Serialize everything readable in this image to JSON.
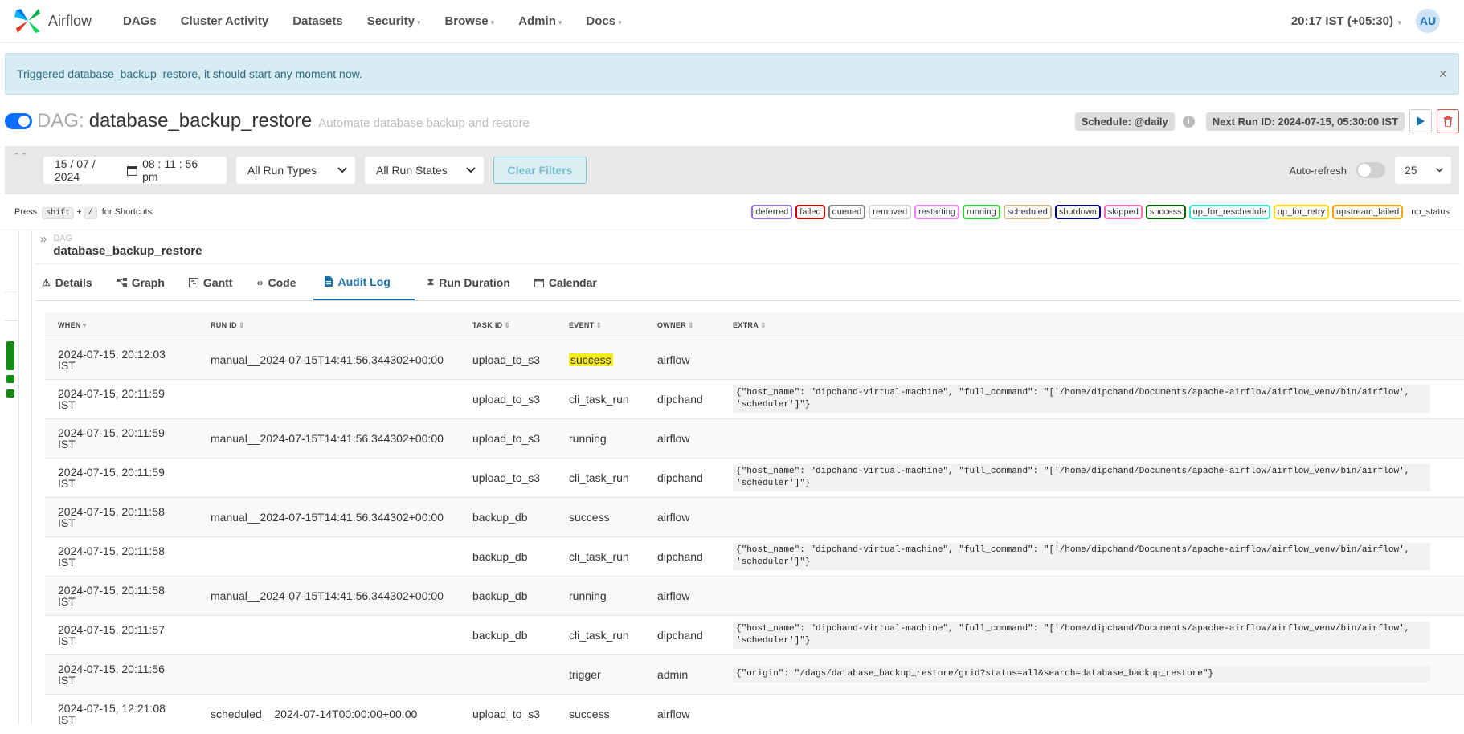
{
  "nav": {
    "brand": "Airflow",
    "items": [
      "DAGs",
      "Cluster Activity",
      "Datasets",
      "Security",
      "Browse",
      "Admin",
      "Docs"
    ],
    "clock": "20:17 IST (+05:30)",
    "avatar": "AU"
  },
  "alert": {
    "message": "Triggered database_backup_restore, it should start any moment now.",
    "close": "×"
  },
  "dag": {
    "label": "DAG:",
    "id": "database_backup_restore",
    "description": "Automate database backup and restore",
    "schedule": "Schedule: @daily",
    "next_run": "Next Run ID: 2024-07-15, 05:30:00 IST"
  },
  "filters": {
    "date": "15 / 07 / 2024",
    "time": "08 : 11 : 56   pm",
    "run_types": "All Run Types",
    "run_states": "All Run States",
    "clear": "Clear Filters",
    "autorefresh": "Auto-refresh",
    "page_size": "25"
  },
  "shortcuts": {
    "press": "Press",
    "key1": "shift",
    "plus": "+",
    "key2": "/",
    "suffix": "for Shortcuts"
  },
  "legend": {
    "states": [
      {
        "name": "deferred",
        "color": "#9370db"
      },
      {
        "name": "failed",
        "color": "#cc0000"
      },
      {
        "name": "queued",
        "color": "#808080"
      },
      {
        "name": "removed",
        "color": "#d3d3d3"
      },
      {
        "name": "restarting",
        "color": "#ee82ee"
      },
      {
        "name": "running",
        "color": "#32cd32"
      },
      {
        "name": "scheduled",
        "color": "#d2b48c"
      },
      {
        "name": "shutdown",
        "color": "#00008b"
      },
      {
        "name": "skipped",
        "color": "#ff69b4"
      },
      {
        "name": "success",
        "color": "#006400"
      },
      {
        "name": "up_for_reschedule",
        "color": "#40e0d0"
      },
      {
        "name": "up_for_retry",
        "color": "#ffd700"
      },
      {
        "name": "upstream_failed",
        "color": "#ffa500"
      }
    ],
    "no_status": "no_status"
  },
  "breadcrumb": {
    "lead": "DAG",
    "id": "database_backup_restore"
  },
  "tabs": [
    {
      "label": "Details",
      "icon": "warning-icon"
    },
    {
      "label": "Graph",
      "icon": "graph-icon"
    },
    {
      "label": "Gantt",
      "icon": "gantt-icon"
    },
    {
      "label": "Code",
      "icon": "code-icon"
    },
    {
      "label": "Audit Log",
      "icon": "audit-log-icon"
    },
    {
      "label": "Run Duration",
      "icon": "hourglass-icon"
    },
    {
      "label": "Calendar",
      "icon": "calendar-icon"
    }
  ],
  "table": {
    "columns": [
      "When",
      "Run ID",
      "Task ID",
      "Event",
      "Owner",
      "Extra"
    ],
    "rows": [
      {
        "when": "2024-07-15, 20:12:03",
        "tz": "IST",
        "run_id": "manual__2024-07-15T14:41:56.344302+00:00",
        "task_id": "upload_to_s3",
        "event": "success",
        "owner": "airflow",
        "extra": ""
      },
      {
        "when": "2024-07-15, 20:11:59",
        "tz": "IST",
        "run_id": "",
        "task_id": "upload_to_s3",
        "event": "cli_task_run",
        "owner": "dipchand",
        "extra": "{\"host_name\": \"dipchand-virtual-machine\", \"full_command\": \"['/home/dipchand/Documents/apache-airflow/airflow_venv/bin/airflow', 'scheduler']\"}"
      },
      {
        "when": "2024-07-15, 20:11:59",
        "tz": "IST",
        "run_id": "manual__2024-07-15T14:41:56.344302+00:00",
        "task_id": "upload_to_s3",
        "event": "running",
        "owner": "airflow",
        "extra": ""
      },
      {
        "when": "2024-07-15, 20:11:59",
        "tz": "IST",
        "run_id": "",
        "task_id": "upload_to_s3",
        "event": "cli_task_run",
        "owner": "dipchand",
        "extra": "{\"host_name\": \"dipchand-virtual-machine\", \"full_command\": \"['/home/dipchand/Documents/apache-airflow/airflow_venv/bin/airflow', 'scheduler']\"}"
      },
      {
        "when": "2024-07-15, 20:11:58",
        "tz": "IST",
        "run_id": "manual__2024-07-15T14:41:56.344302+00:00",
        "task_id": "backup_db",
        "event": "success",
        "owner": "airflow",
        "extra": ""
      },
      {
        "when": "2024-07-15, 20:11:58",
        "tz": "IST",
        "run_id": "",
        "task_id": "backup_db",
        "event": "cli_task_run",
        "owner": "dipchand",
        "extra": "{\"host_name\": \"dipchand-virtual-machine\", \"full_command\": \"['/home/dipchand/Documents/apache-airflow/airflow_venv/bin/airflow', 'scheduler']\"}"
      },
      {
        "when": "2024-07-15, 20:11:58",
        "tz": "IST",
        "run_id": "manual__2024-07-15T14:41:56.344302+00:00",
        "task_id": "backup_db",
        "event": "running",
        "owner": "airflow",
        "extra": ""
      },
      {
        "when": "2024-07-15, 20:11:57",
        "tz": "IST",
        "run_id": "",
        "task_id": "backup_db",
        "event": "cli_task_run",
        "owner": "dipchand",
        "extra": "{\"host_name\": \"dipchand-virtual-machine\", \"full_command\": \"['/home/dipchand/Documents/apache-airflow/airflow_venv/bin/airflow', 'scheduler']\"}"
      },
      {
        "when": "2024-07-15, 20:11:56",
        "tz": "IST",
        "run_id": "",
        "task_id": "",
        "event": "trigger",
        "owner": "admin",
        "extra": "{\"origin\": \"/dags/database_backup_restore/grid?status=all&search=database_backup_restore\"}"
      },
      {
        "when": "2024-07-15, 12:21:08",
        "tz": "IST",
        "run_id": "scheduled__2024-07-14T00:00:00+00:00",
        "task_id": "upload_to_s3",
        "event": "success",
        "owner": "airflow",
        "extra": ""
      }
    ]
  }
}
